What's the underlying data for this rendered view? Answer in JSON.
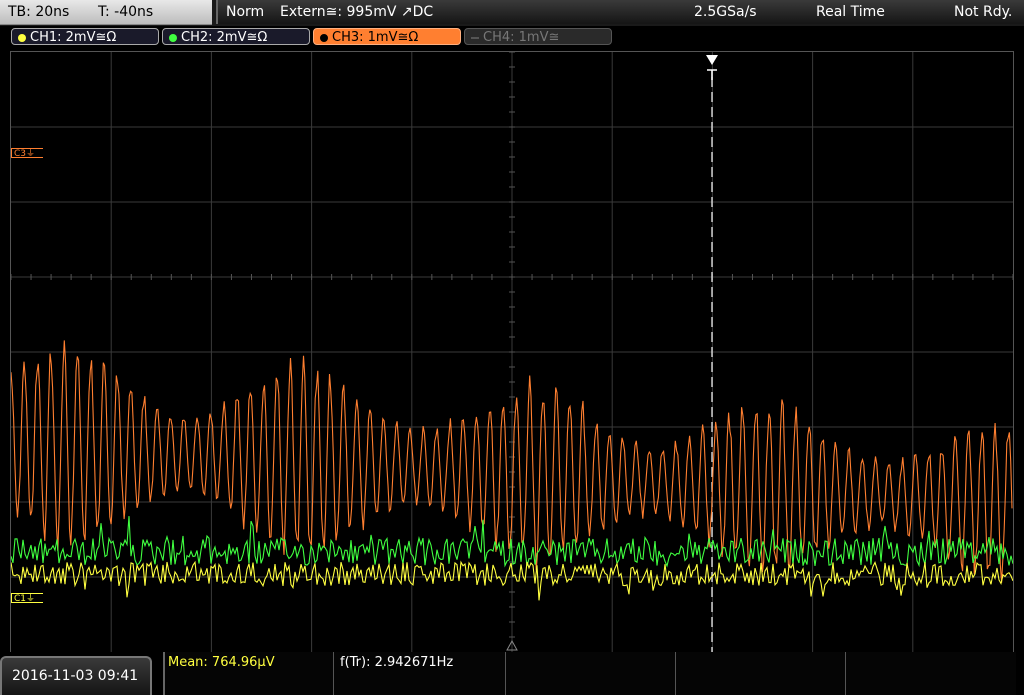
{
  "top": {
    "timebase": "TB: 20ns",
    "trigger_time": "T: -40ns",
    "mode": "Norm",
    "trigger": "Extern≅: 995mV ↗DC",
    "sample_rate": "2.5GSa/s",
    "acq_mode": "Real Time",
    "status": "Not Rdy."
  },
  "channels": [
    {
      "label": "CH1: 2mV≅Ω",
      "color": "#ffff40"
    },
    {
      "label": "CH2: 2mV≅Ω",
      "color": "#40ff40"
    },
    {
      "label": "CH3: 1mV≅Ω",
      "color": "#ff7f30"
    },
    {
      "label": "CH4: 1mV≅",
      "color": "#777777"
    }
  ],
  "markers": {
    "c3": "C3⏚",
    "c1": "C1⏚"
  },
  "bottom": {
    "datetime": "2016-11-03 09:41",
    "measurement_mean": "Mean: 764.96µV",
    "measurement_freq": "f(Tr): 2.942671Hz"
  },
  "colors": {
    "ch1": "#ffff40",
    "ch2": "#40ff40",
    "ch3": "#ff7f30",
    "grid": "#3a3a3a"
  }
}
